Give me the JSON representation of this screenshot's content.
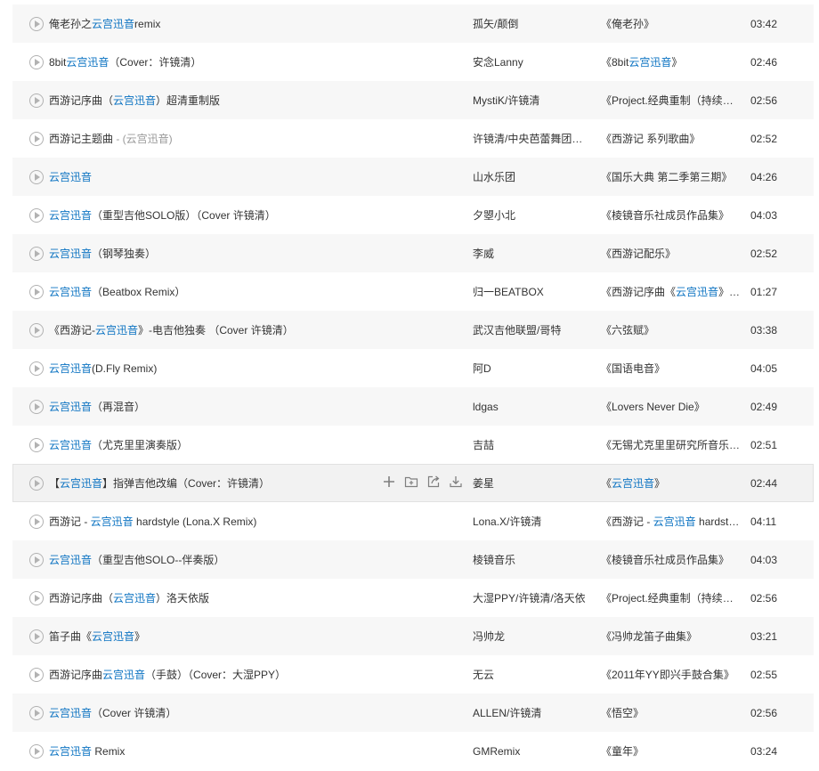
{
  "colors": {
    "link": "#0c73c2",
    "text": "#333333",
    "muted": "#999999",
    "row_alt": "#f7f7f7",
    "row_hover": "#f2f2f2"
  },
  "row_actions": [
    "add-icon",
    "collect-folder-icon",
    "share-icon",
    "download-icon"
  ],
  "songs": [
    {
      "title": [
        {
          "t": "俺老孙之"
        },
        {
          "t": "云宫迅音",
          "hl": true
        },
        {
          "t": "remix"
        }
      ],
      "artist": "孤矢/颠倒",
      "album": [
        {
          "t": "《俺老孙》"
        }
      ],
      "duration": "03:42"
    },
    {
      "title": [
        {
          "t": "8bit"
        },
        {
          "t": "云宫迅音",
          "hl": true
        },
        {
          "t": "（Cover：许镜清）"
        }
      ],
      "artist": "安念Lanny",
      "album": [
        {
          "t": "《8bit"
        },
        {
          "t": "云宫迅音",
          "hl": true
        },
        {
          "t": "》"
        }
      ],
      "duration": "02:46"
    },
    {
      "title": [
        {
          "t": "西游记序曲（"
        },
        {
          "t": "云宫迅音",
          "hl": true
        },
        {
          "t": "）超清重制版"
        }
      ],
      "artist": "MystiK/许镜清",
      "album": [
        {
          "t": "《Project.经典重制（持续更新中）》"
        }
      ],
      "duration": "02:56"
    },
    {
      "title": [
        {
          "t": "西游记主题曲"
        },
        {
          "t": " - (云宫迅音)",
          "dim": true
        }
      ],
      "artist": "许镜清/中央芭蕾舞团管弦乐队",
      "album": [
        {
          "t": "《西游记 系列歌曲》"
        }
      ],
      "duration": "02:52"
    },
    {
      "title": [
        {
          "t": "云宫迅音",
          "hl": true
        }
      ],
      "artist": "山水乐团",
      "album": [
        {
          "t": "《国乐大典 第二季第三期》"
        }
      ],
      "duration": "04:26"
    },
    {
      "title": [
        {
          "t": "云宫迅音",
          "hl": true
        },
        {
          "t": "（重型吉他SOLO版）（Cover 许镜清）"
        }
      ],
      "artist": "夕曌小北",
      "album": [
        {
          "t": "《棱镜音乐社成员作品集》"
        }
      ],
      "duration": "04:03"
    },
    {
      "title": [
        {
          "t": "云宫迅音",
          "hl": true
        },
        {
          "t": "（钢琴独奏）"
        }
      ],
      "artist": "李威",
      "album": [
        {
          "t": "《西游记配乐》"
        }
      ],
      "duration": "02:52"
    },
    {
      "title": [
        {
          "t": "云宫迅音",
          "hl": true
        },
        {
          "t": "（Beatbox Remix）"
        }
      ],
      "artist": "归一BEATBOX",
      "album": [
        {
          "t": "《西游记序曲《"
        },
        {
          "t": "云宫迅音",
          "hl": true
        },
        {
          "t": "》Beatbox Remix》"
        }
      ],
      "duration": "01:27"
    },
    {
      "title": [
        {
          "t": "《西游记-"
        },
        {
          "t": "云宫迅音",
          "hl": true
        },
        {
          "t": "》-电吉他独奏 （Cover 许镜清）"
        }
      ],
      "artist": "武汉吉他联盟/哥特",
      "album": [
        {
          "t": "《六弦赋》"
        }
      ],
      "duration": "03:38"
    },
    {
      "title": [
        {
          "t": "云宫迅音",
          "hl": true
        },
        {
          "t": "(D.Fly Remix)"
        }
      ],
      "artist": "阿D",
      "album": [
        {
          "t": "《国语电音》"
        }
      ],
      "duration": "04:05"
    },
    {
      "title": [
        {
          "t": "云宫迅音",
          "hl": true
        },
        {
          "t": "（再混音）"
        }
      ],
      "artist": "ldgas",
      "album": [
        {
          "t": "《Lovers Never Die》"
        }
      ],
      "duration": "02:49"
    },
    {
      "title": [
        {
          "t": "云宫迅音",
          "hl": true
        },
        {
          "t": "（尤克里里演奏版）"
        }
      ],
      "artist": "吉喆",
      "album": [
        {
          "t": "《无锡尤克里里研究所音乐作品集》"
        }
      ],
      "duration": "02:51"
    },
    {
      "title": [
        {
          "t": "【"
        },
        {
          "t": "云宫迅音",
          "hl": true
        },
        {
          "t": "】指弹吉他改编（Cover：许镜清）"
        }
      ],
      "artist": "姜星",
      "album": [
        {
          "t": "《"
        },
        {
          "t": "云宫迅音",
          "hl": true
        },
        {
          "t": "》"
        }
      ],
      "duration": "02:44",
      "hover": true
    },
    {
      "title": [
        {
          "t": "西游记 - "
        },
        {
          "t": "云宫迅音",
          "hl": true
        },
        {
          "t": " hardstyle (Lona.X Remix)"
        }
      ],
      "artist": "Lona.X/许镜清",
      "album": [
        {
          "t": "《西游记 - "
        },
        {
          "t": "云宫迅音",
          "hl": true
        },
        {
          "t": " hardstyle (Lona.X Remix)》"
        }
      ],
      "duration": "04:11"
    },
    {
      "title": [
        {
          "t": "云宫迅音",
          "hl": true
        },
        {
          "t": "（重型吉他SOLO--伴奏版）"
        }
      ],
      "artist": "棱镜音乐",
      "album": [
        {
          "t": "《棱镜音乐社成员作品集》"
        }
      ],
      "duration": "04:03"
    },
    {
      "title": [
        {
          "t": "西游记序曲（"
        },
        {
          "t": "云宫迅音",
          "hl": true
        },
        {
          "t": "）洛天依版"
        }
      ],
      "artist": "大湿PPY/许镜清/洛天依",
      "album": [
        {
          "t": "《Project.经典重制（持续更新中）》"
        }
      ],
      "duration": "02:56"
    },
    {
      "title": [
        {
          "t": "笛子曲《"
        },
        {
          "t": "云宫迅音",
          "hl": true
        },
        {
          "t": "》"
        }
      ],
      "artist": "冯帅龙",
      "album": [
        {
          "t": "《冯帅龙笛子曲集》"
        }
      ],
      "duration": "03:21"
    },
    {
      "title": [
        {
          "t": "西游记序曲"
        },
        {
          "t": "云宫迅音",
          "hl": true
        },
        {
          "t": "（手鼓）（Cover：大湿PPY）"
        }
      ],
      "artist": "无云",
      "album": [
        {
          "t": "《2011年YY即兴手鼓合集》"
        }
      ],
      "duration": "02:55"
    },
    {
      "title": [
        {
          "t": "云宫迅音",
          "hl": true
        },
        {
          "t": "（Cover 许镜清）"
        }
      ],
      "artist": "ALLEN/许镜清",
      "album": [
        {
          "t": "《悟空》"
        }
      ],
      "duration": "02:56"
    },
    {
      "title": [
        {
          "t": "云宫迅音",
          "hl": true
        },
        {
          "t": " Remix"
        }
      ],
      "artist": "GMRemix",
      "album": [
        {
          "t": "《童年》"
        }
      ],
      "duration": "03:24"
    }
  ]
}
